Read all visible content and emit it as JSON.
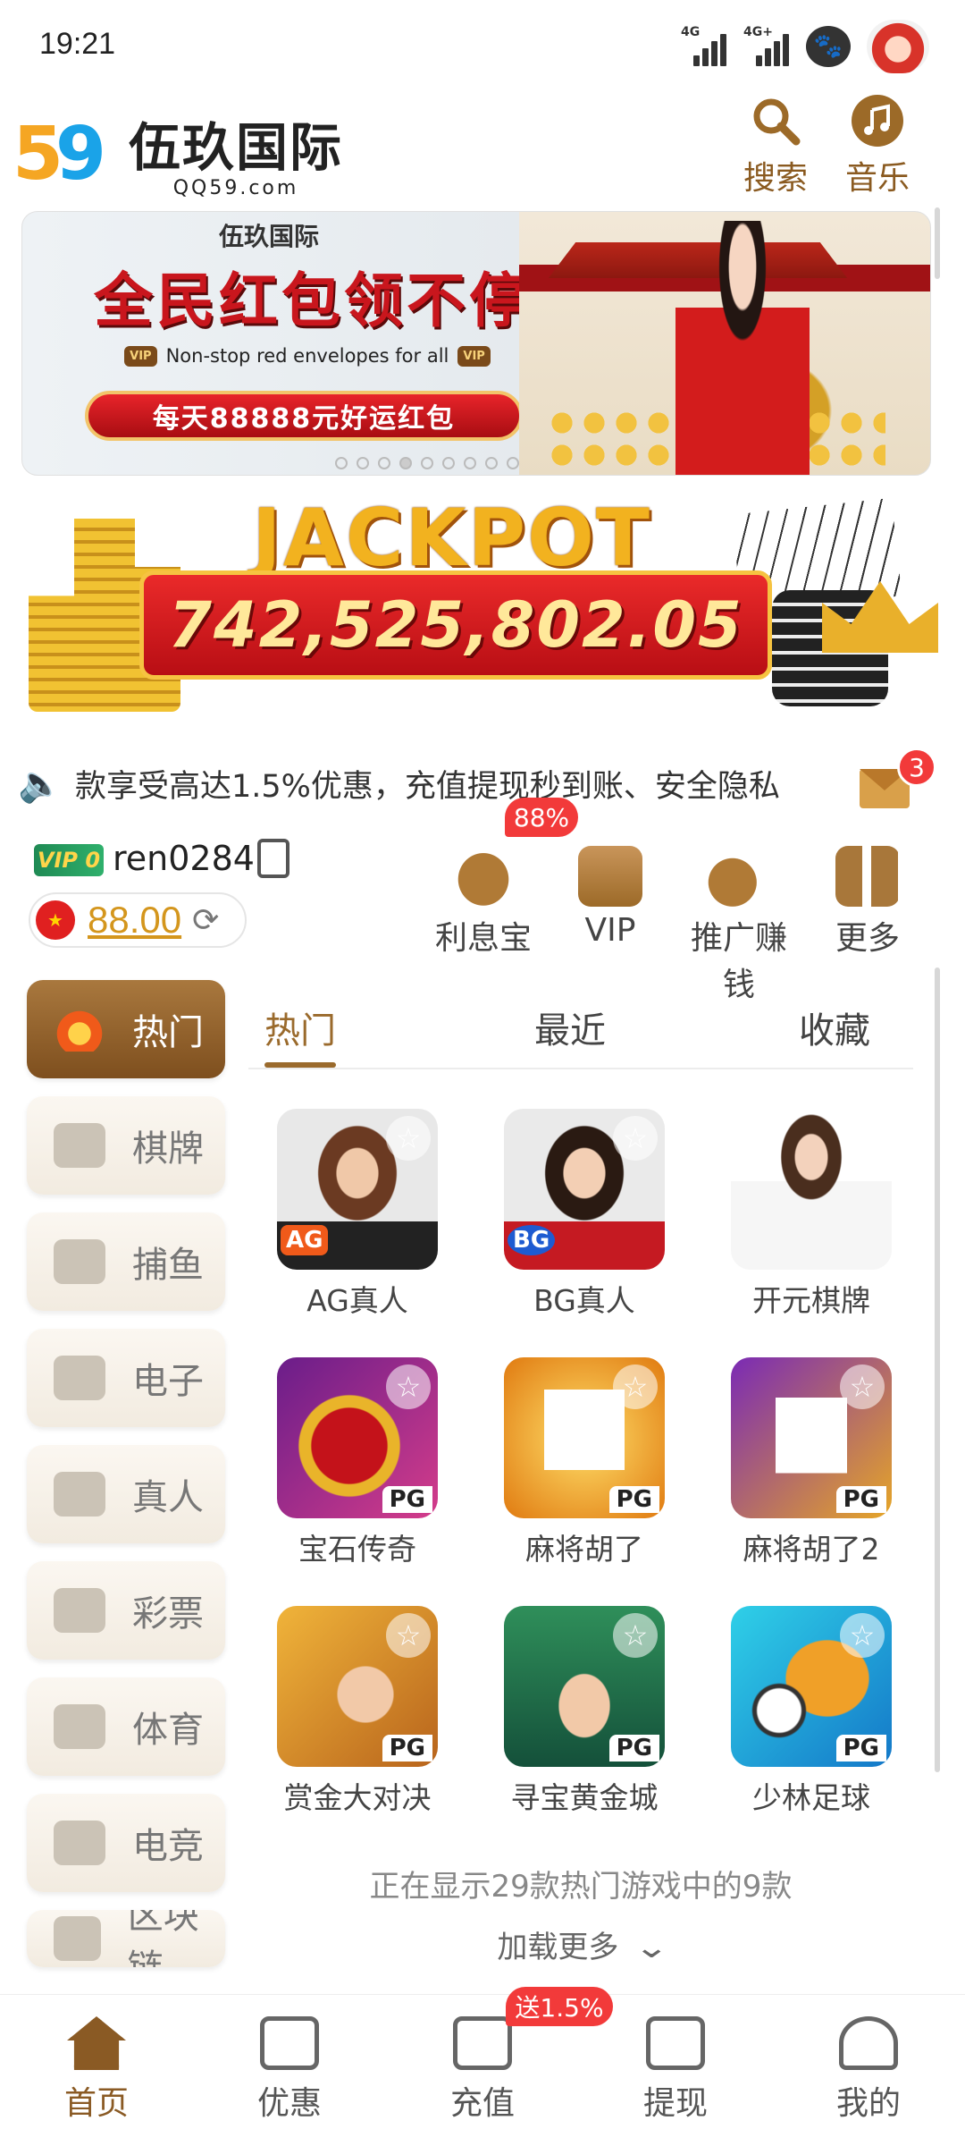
{
  "status": {
    "time": "19:21",
    "signal1": "4G",
    "signal2": "4G+"
  },
  "header": {
    "logo_cn": "伍玖国际",
    "logo_url": "QQ59.com",
    "search_label": "搜索",
    "music_label": "音乐"
  },
  "banner": {
    "logo_text": "伍玖国际",
    "title": "全民红包领不停",
    "vip_tag": "VIP",
    "subtitle": "Non-stop red envelopes for all",
    "pill": "每天88888元好运红包",
    "dots_total": 9,
    "dots_active": 4
  },
  "jackpot": {
    "title": "JACKPOT",
    "amount": "742,525,802.05"
  },
  "notice": {
    "text": "款享受高达1.5%优惠，充值提现秒到账、安全隐私",
    "mail_count": "3"
  },
  "user": {
    "vip_level": "VIP 0",
    "username": "ren0284",
    "balance": "88.00"
  },
  "quick_actions": [
    {
      "label": "利息宝",
      "badge": "88%"
    },
    {
      "label": "VIP"
    },
    {
      "label": "推广赚钱"
    },
    {
      "label": "更多"
    }
  ],
  "categories": [
    {
      "label": "热门",
      "active": true
    },
    {
      "label": "棋牌"
    },
    {
      "label": "捕鱼"
    },
    {
      "label": "电子"
    },
    {
      "label": "真人"
    },
    {
      "label": "彩票"
    },
    {
      "label": "体育"
    },
    {
      "label": "电竞"
    },
    {
      "label": "区块链"
    }
  ],
  "tabs": [
    "热门",
    "最近",
    "收藏"
  ],
  "games": [
    {
      "name": "AG真人",
      "provider": "AG"
    },
    {
      "name": "BG真人",
      "provider": "BG"
    },
    {
      "name": "开元棋牌",
      "provider": ""
    },
    {
      "name": "宝石传奇",
      "provider": "PG"
    },
    {
      "name": "麻将胡了",
      "provider": "PG"
    },
    {
      "name": "麻将胡了2",
      "provider": "PG"
    },
    {
      "name": "赏金大对决",
      "provider": "PG"
    },
    {
      "name": "寻宝黄金城",
      "provider": "PG"
    },
    {
      "name": "少林足球",
      "provider": "PG"
    }
  ],
  "showing_text": "正在显示29款热门游戏中的9款",
  "load_more": "加载更多",
  "bottom_nav": [
    {
      "label": "首页",
      "active": true
    },
    {
      "label": "优惠"
    },
    {
      "label": "充值",
      "badge": "送1.5%"
    },
    {
      "label": "提现"
    },
    {
      "label": "我的"
    }
  ],
  "colors": {
    "accent": "#8a5a24",
    "gold": "#d4961d",
    "badge_red": "#f23a3a"
  }
}
